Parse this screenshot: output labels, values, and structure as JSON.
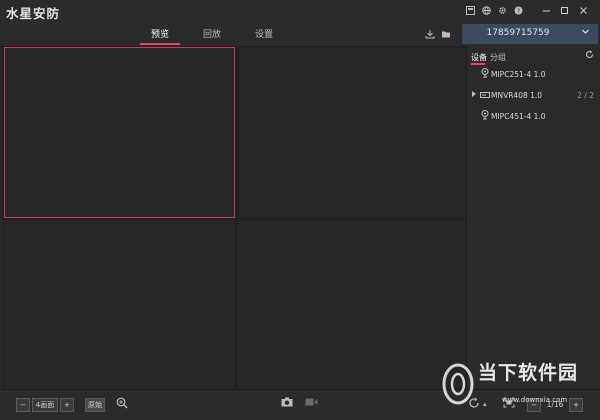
{
  "app": {
    "title": "水星安防",
    "title_icons": [
      "layout-icon",
      "globe-icon",
      "gear-icon",
      "help-icon"
    ],
    "window_controls": [
      "minimize-icon",
      "maximize-icon",
      "close-icon"
    ]
  },
  "tabs": [
    {
      "label": "预览",
      "active": true
    },
    {
      "label": "回放",
      "active": false
    },
    {
      "label": "设置",
      "active": false
    }
  ],
  "account": {
    "phone": "17859715759"
  },
  "sidebar": {
    "tabs": [
      {
        "label": "设备",
        "active": true
      },
      {
        "label": "分组",
        "active": false
      }
    ],
    "devices": [
      {
        "name": "MIPC251-4 1.0",
        "icon": "camera-icon",
        "count": ""
      },
      {
        "name": "MNVR408 1.0",
        "icon": "nvr-icon",
        "count": "2 / 2"
      },
      {
        "name": "MIPC451-4 1.0",
        "icon": "camera-icon",
        "count": ""
      }
    ]
  },
  "bottombar": {
    "layout_label": "4画面",
    "ratio_label": "原始",
    "page_indicator": "1/16"
  },
  "watermark": {
    "text": "当下软件园",
    "url": "www.downxia.com"
  },
  "colors": {
    "accent": "#e0466b",
    "selection_border": "#c23b5d",
    "account_bg": "#3b4a5c",
    "background": "#262626"
  }
}
